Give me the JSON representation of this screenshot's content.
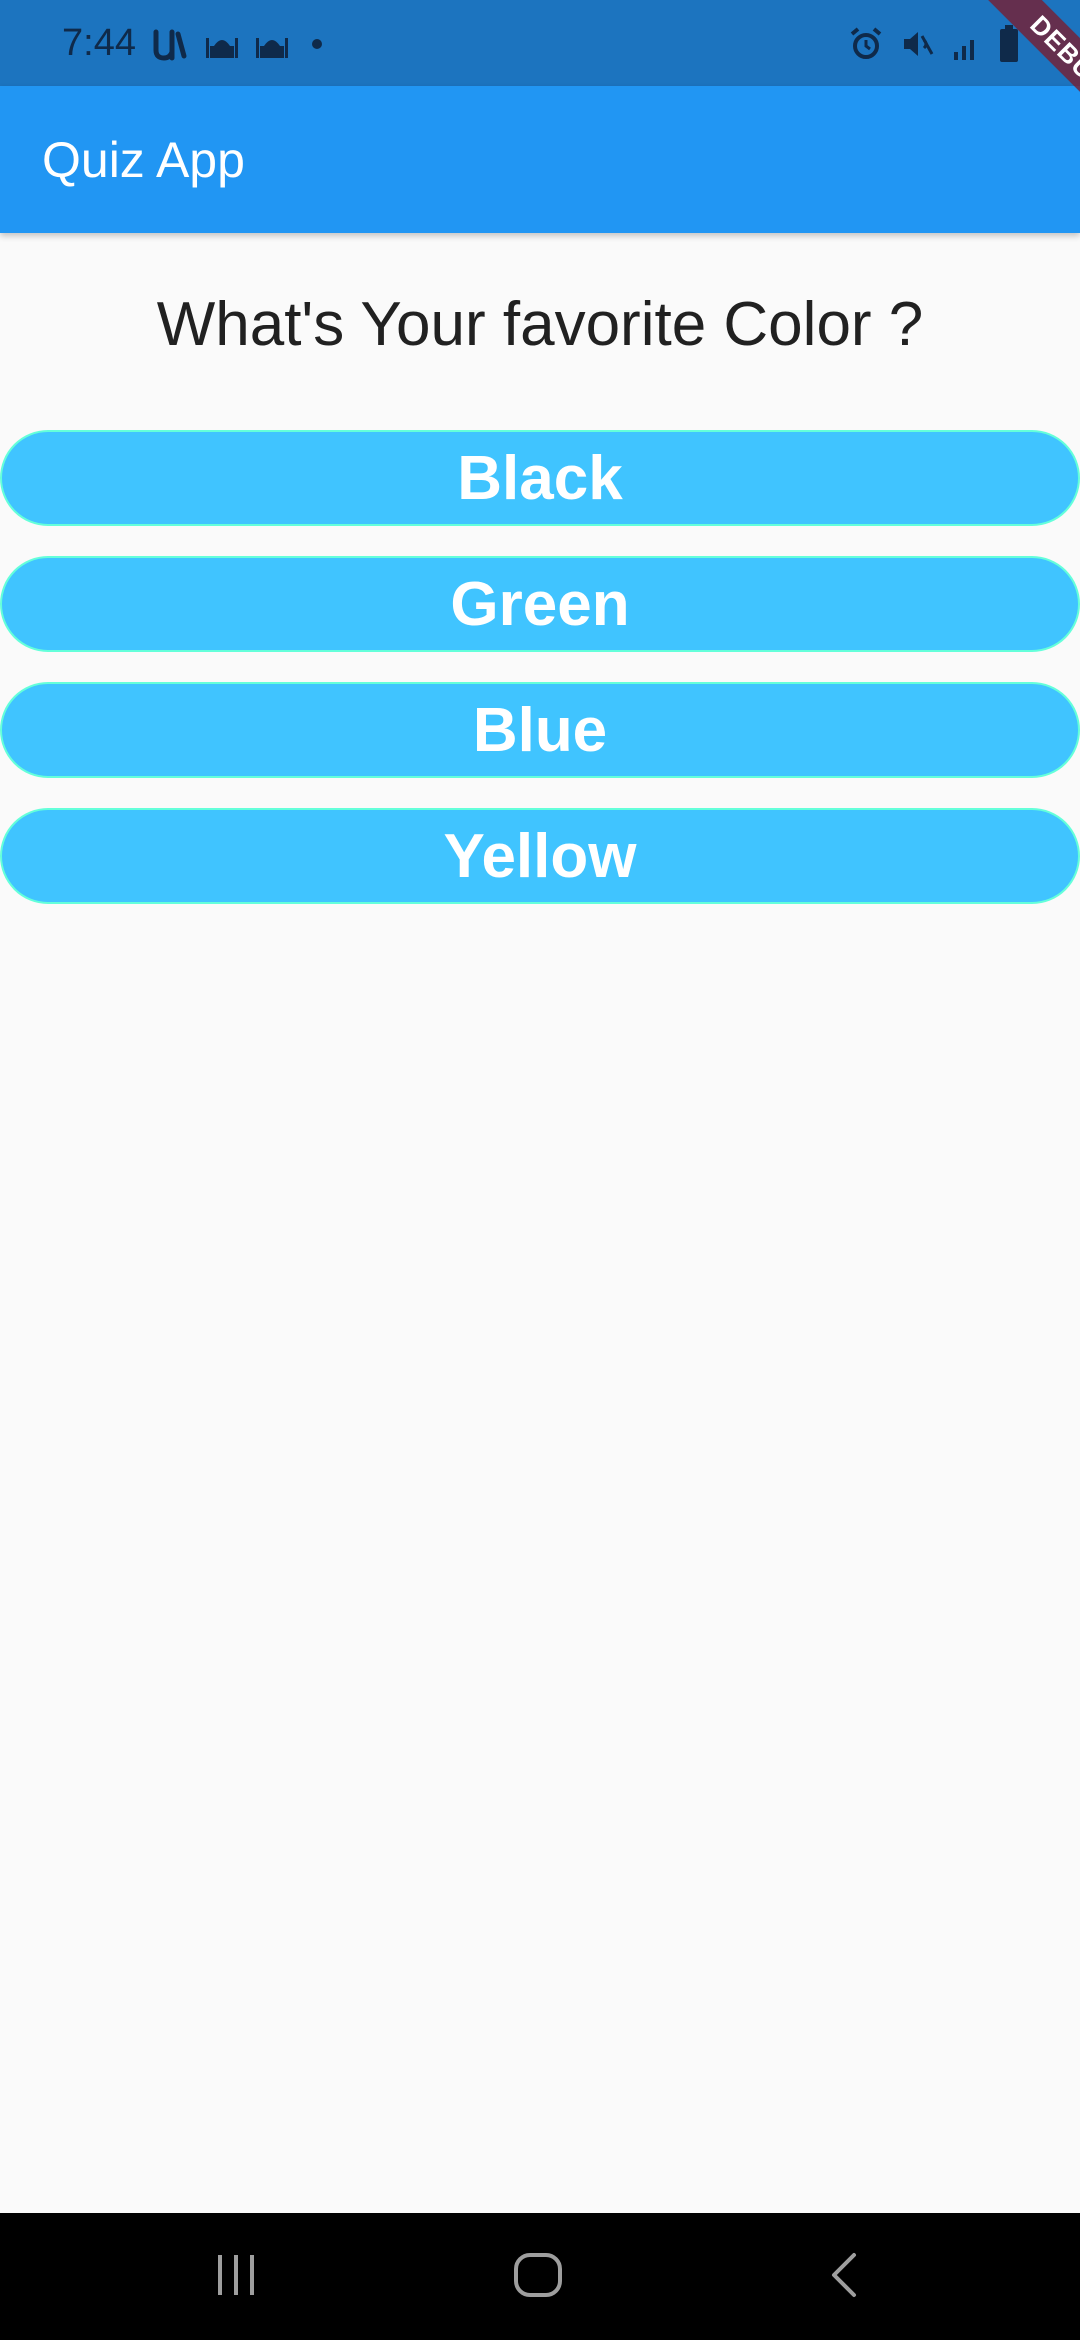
{
  "status_bar": {
    "time": "7:44",
    "left_icons": [
      "u-app-icon",
      "mosque-icon",
      "mosque-icon",
      "dot-icon"
    ],
    "right_icons": [
      "alarm-icon",
      "mute-icon",
      "signal-icon",
      "battery-icon"
    ]
  },
  "app_bar": {
    "title": "Quiz App"
  },
  "debug_banner": {
    "label": "DEBUG"
  },
  "question": {
    "text": "What's Your favorite Color ?"
  },
  "answers": [
    {
      "label": "Black"
    },
    {
      "label": "Green"
    },
    {
      "label": "Blue"
    },
    {
      "label": "Yellow"
    }
  ],
  "colors": {
    "status_bar": "#1c74bf",
    "app_bar": "#2196f3",
    "button_fill": "#40c4ff",
    "button_border": "#64ffda",
    "background": "#fafafa"
  },
  "nav_bar": {
    "icons": [
      "recent-apps-icon",
      "home-icon",
      "back-icon"
    ]
  }
}
